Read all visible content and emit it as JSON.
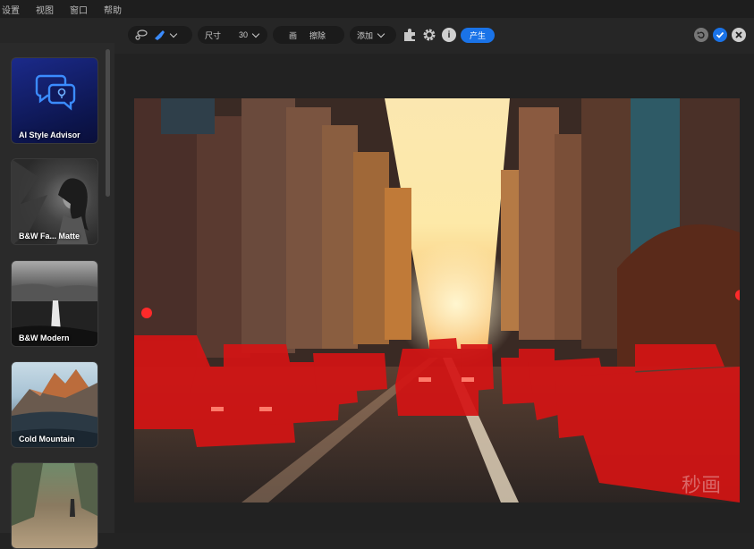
{
  "menu": [
    "设置",
    "视图",
    "窗口",
    "帮助"
  ],
  "toolbar": {
    "size_label": "尺寸",
    "size_value": "30",
    "brush_label": "画",
    "erase_label": "擦除",
    "mode_label": "添加",
    "generate_label": "产生"
  },
  "sidebar": {
    "cards": [
      {
        "label": "AI Style Advisor"
      },
      {
        "label": "B&W Fa... Matte"
      },
      {
        "label": "B&W Modern"
      },
      {
        "label": "Cold Mountain"
      },
      {
        "label": ""
      }
    ]
  },
  "watermark": "秒画",
  "colors": {
    "accent": "#1a73e8",
    "mask": "#d41414",
    "background": "#232323"
  }
}
